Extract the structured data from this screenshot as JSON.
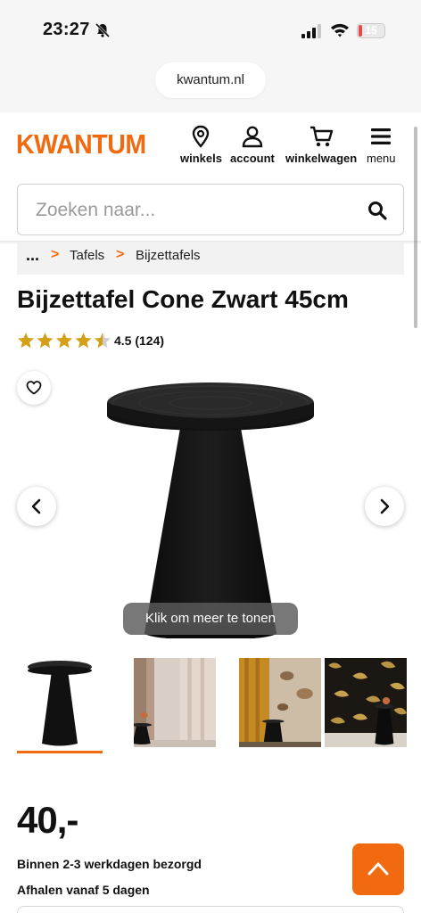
{
  "status_bar": {
    "time": "23:27",
    "battery": "15",
    "battery_color": "#e5484d"
  },
  "browser": {
    "url": "kwantum.nl"
  },
  "header": {
    "logo": "KWANTUM",
    "brand_color": "#f26a10",
    "nav": [
      {
        "label": "winkels",
        "icon": "location-pin-icon"
      },
      {
        "label": "account",
        "icon": "user-icon"
      },
      {
        "label": "winkelwagen",
        "icon": "cart-icon"
      },
      {
        "label": "menu",
        "icon": "hamburger-icon"
      }
    ]
  },
  "search": {
    "placeholder": "Zoeken naar...",
    "icon": "search-icon"
  },
  "breadcrumb": {
    "ellipsis": "...",
    "items": [
      "Tafels",
      "Bijzettafels"
    ]
  },
  "product": {
    "title": "Bijzettafel Cone Zwart 45cm",
    "rating_value": 4.5,
    "rating_max": 5,
    "rating_text": "4.5 (124)",
    "more_label": "Klik om meer te tonen",
    "price": "40,-",
    "delivery": "Binnen 2-3 werkdagen bezorgd",
    "pickup": "Afhalen vanaf 5 dagen"
  },
  "thumbnails": [
    {
      "name": "product-thumb",
      "selected": true
    },
    {
      "name": "curtain-room-thumb",
      "selected": false
    },
    {
      "name": "ochre-curtain-thumb",
      "selected": false
    },
    {
      "name": "wallpaper-thumb",
      "selected": false
    }
  ]
}
